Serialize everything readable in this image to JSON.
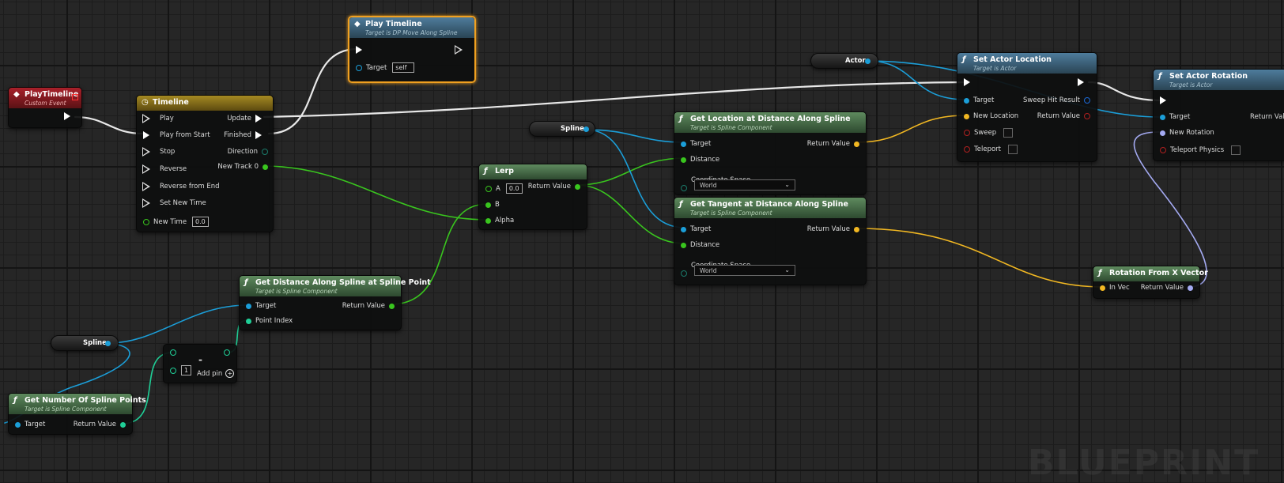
{
  "colors": {
    "exec": "#ffffff",
    "object": "#1b9ed8",
    "float": "#39c51e",
    "int": "#1fcf97",
    "vector": "#f1b722",
    "rotator": "#a4aaf2",
    "bool": "#9b1a1a"
  },
  "watermark": "BLUEPRINT",
  "nodes": {
    "play_timeline_event": {
      "title": "PlayTimeline",
      "subtitle": "Custom Event"
    },
    "timeline": {
      "title": "Timeline",
      "play": "Play",
      "play_from_start": "Play from Start",
      "stop": "Stop",
      "reverse": "Reverse",
      "reverse_from_end": "Reverse from End",
      "set_new_time": "Set New Time",
      "new_time": "New Time",
      "new_time_value": "0.0",
      "update": "Update",
      "finished": "Finished",
      "direction": "Direction",
      "new_track": "New Track 0"
    },
    "play_timeline_call": {
      "title": "Play Timeline",
      "subtitle": "Target is DP Move Along Spline",
      "target": "Target",
      "target_value": "self"
    },
    "spline_var_top": {
      "label": "Spline"
    },
    "spline_var_bottom": {
      "label": "Spline"
    },
    "actor_var": {
      "label": "Actor"
    },
    "lerp": {
      "title": "Lerp",
      "a": "A",
      "a_value": "0.0",
      "b": "B",
      "alpha": "Alpha",
      "return_value": "Return Value"
    },
    "get_location": {
      "title": "Get Location at Distance Along Spline",
      "subtitle": "Target is Spline Component",
      "target": "Target",
      "distance": "Distance",
      "coordinate_space": "Coordinate Space",
      "coordinate_value": "World",
      "return_value": "Return Value"
    },
    "get_tangent": {
      "title": "Get Tangent at Distance Along Spline",
      "subtitle": "Target is Spline Component",
      "target": "Target",
      "distance": "Distance",
      "coordinate_space": "Coordinate Space",
      "coordinate_value": "World",
      "return_value": "Return Value"
    },
    "set_actor_location": {
      "title": "Set Actor Location",
      "subtitle": "Target is Actor",
      "target": "Target",
      "new_location": "New Location",
      "sweep": "Sweep",
      "teleport": "Teleport",
      "sweep_hit_result": "Sweep Hit Result",
      "return_value": "Return Value"
    },
    "set_actor_rotation": {
      "title": "Set Actor Rotation",
      "subtitle": "Target is Actor",
      "target": "Target",
      "new_rotation": "New Rotation",
      "teleport_physics": "Teleport Physics",
      "return_value": "Return Valu"
    },
    "rotation_from_x": {
      "title": "Rotation From X Vector",
      "in_vec": "In Vec",
      "return_value": "Return Value"
    },
    "get_distance_at_point": {
      "title": "Get Distance Along Spline at Spline Point",
      "subtitle": "Target is Spline Component",
      "target": "Target",
      "point_index": "Point Index",
      "return_value": "Return Value"
    },
    "subtract": {
      "symbol": "-",
      "value": "1",
      "add_pin": "Add pin"
    },
    "get_num_points": {
      "title": "Get Number Of Spline Points",
      "subtitle": "Target is Spline Component",
      "target": "Target",
      "return_value": "Return Value"
    }
  }
}
